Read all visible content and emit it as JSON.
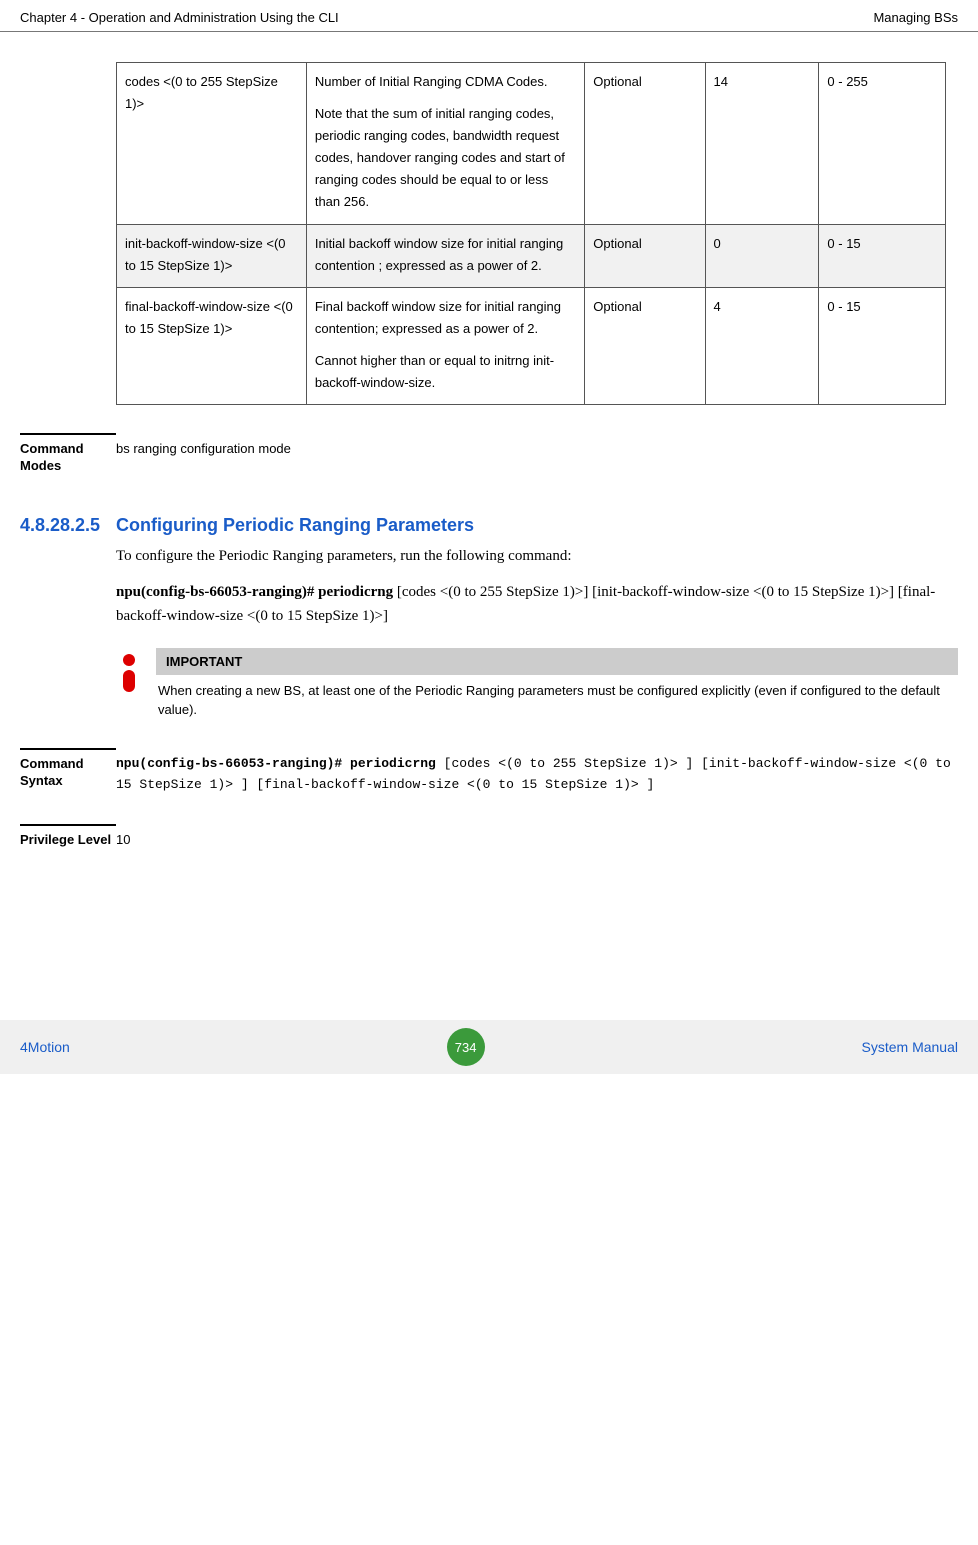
{
  "header": {
    "left": "Chapter 4 - Operation and Administration Using the CLI",
    "right": "Managing BSs"
  },
  "table": {
    "rows": [
      {
        "shaded": false,
        "param": "codes <(0 to 255 StepSize 1)>",
        "desc1": "Number of Initial Ranging CDMA Codes.",
        "desc2": "Note that the sum of initial ranging codes, periodic ranging codes, bandwidth request codes, handover ranging codes and start of ranging codes should be equal to or less than 256.",
        "presence": "Optional",
        "default": "14",
        "range": "0 - 255"
      },
      {
        "shaded": true,
        "param": "init-backoff-window-size <(0 to 15 StepSize 1)>",
        "desc1": "Initial backoff window size for initial ranging contention ; expressed as a power of 2.",
        "desc2": "",
        "presence": "Optional",
        "default": "0",
        "range": "0 - 15"
      },
      {
        "shaded": false,
        "param": "final-backoff-window-size <(0 to 15 StepSize 1)>",
        "desc1": "Final backoff window size for initial ranging contention; expressed as a power of 2.",
        "desc2": "Cannot higher than or equal to initrng  init-backoff-window-size.",
        "presence": "Optional",
        "default": "4",
        "range": "0 - 15"
      }
    ]
  },
  "command_modes": {
    "label": "Command Modes",
    "value": "bs ranging configuration mode"
  },
  "section": {
    "number": "4.8.28.2.5",
    "title": "Configuring Periodic Ranging Parameters",
    "intro": "To configure the Periodic Ranging parameters, run the following command:",
    "cmd_bold": "npu(config-bs-66053-ranging)# periodicrng",
    "cmd_rest": " [codes <(0 to 255 StepSize 1)>] [init-backoff-window-size <(0 to 15 StepSize 1)>] [final-backoff-window-size <(0 to 15 StepSize 1)>]"
  },
  "important": {
    "header": "IMPORTANT",
    "text": "When creating a new BS, at least one of the Periodic Ranging parameters must be configured explicitly (even if configured to the default value)."
  },
  "command_syntax": {
    "label": "Command Syntax",
    "bold": "npu(config-bs-66053-ranging)# periodicrng",
    "rest": " [codes <(0 to 255 StepSize 1)> ] [init-backoff-window-size <(0 to 15 StepSize 1)> ] [final-backoff-window-size <(0 to 15 StepSize 1)> ]"
  },
  "privilege": {
    "label": "Privilege Level",
    "value": "10"
  },
  "footer": {
    "brand": "4Motion",
    "page": "734",
    "sys": "System Manual"
  }
}
